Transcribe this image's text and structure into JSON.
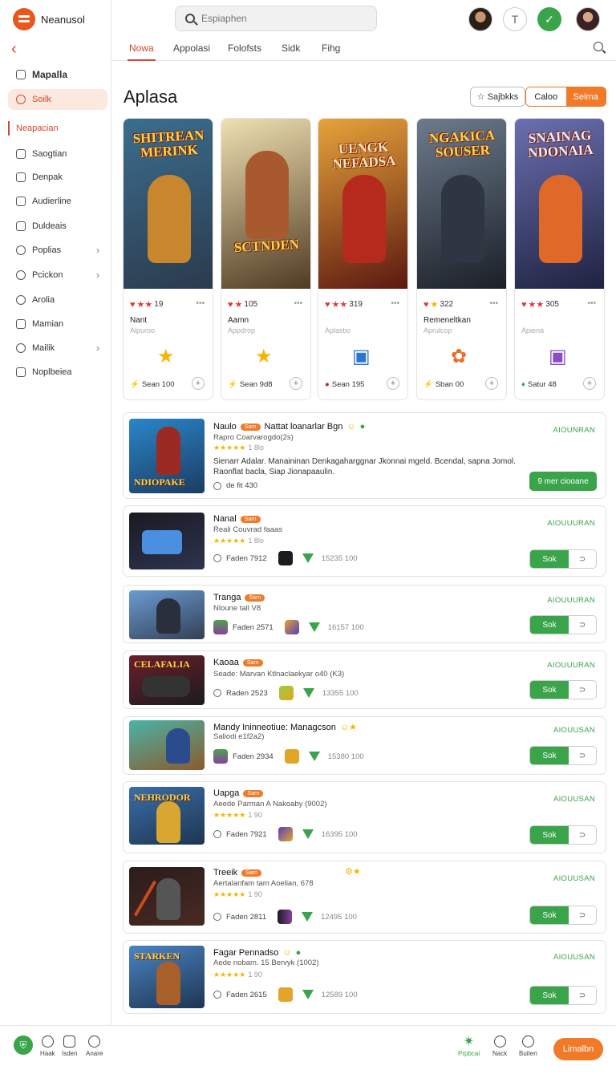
{
  "brand": {
    "name": "Neanusol"
  },
  "sidebar": {
    "items": [
      {
        "label": "Mapalla"
      },
      {
        "label": "Soilk"
      },
      {
        "label": "Neapacian"
      },
      {
        "label": "Saogtian"
      },
      {
        "label": "Denpak"
      },
      {
        "label": "Audierline"
      },
      {
        "label": "Duldeais"
      },
      {
        "label": "Poplias"
      },
      {
        "label": "Pcickon"
      },
      {
        "label": "Arolia"
      },
      {
        "label": "Mamian"
      },
      {
        "label": "Mailik"
      },
      {
        "label": "Noplbeiea"
      }
    ]
  },
  "search": {
    "placeholder": "Espiaphen"
  },
  "header": {
    "avatar_letter": "T"
  },
  "tabs": [
    {
      "label": "Nowa"
    },
    {
      "label": "Appolasi"
    },
    {
      "label": "Folofsts"
    },
    {
      "label": "Sidk"
    },
    {
      "label": "Fihg"
    }
  ],
  "page": {
    "title": "Aplasa",
    "btn_outline": "Sajbkks",
    "seg_left": "Caloo",
    "seg_right": "Seima"
  },
  "featured": [
    {
      "art_title": "SHITREAN MERINK",
      "rating": "19",
      "name": "Nant",
      "sub": "Alpuroo",
      "foot": "Sean 100",
      "colors": [
        "#3b6e8f",
        "#c8872c",
        "#2b3a4c"
      ]
    },
    {
      "art_title": "SCTNDEN",
      "rating": "105",
      "name": "Aamn",
      "sub": "Appdrop",
      "foot": "Sean 9d8",
      "colors": [
        "#efe0b2",
        "#a8592e",
        "#4f3a22"
      ]
    },
    {
      "art_title": "UENGK NEFADSA",
      "rating": "319",
      "name": "",
      "sub": "Aplastio",
      "foot": "Sean 195",
      "colors": [
        "#e7a33a",
        "#b62a1e",
        "#5b1810"
      ]
    },
    {
      "art_title": "NGAKICA SOUSER",
      "rating": "322",
      "name": "Remeneltkan",
      "sub": "Aprulcop",
      "foot": "Sban 00",
      "colors": [
        "#6c7b8c",
        "#2d3642",
        "#1b1f27"
      ]
    },
    {
      "art_title": "SNAINAG NDONAIA",
      "rating": "305",
      "name": "",
      "sub": "Apiena",
      "foot": "Satur 48",
      "colors": [
        "#6b6fb0",
        "#e0692a",
        "#1f2240"
      ]
    }
  ],
  "rows": [
    {
      "name": "Naulo",
      "tag": "Sarn",
      "name_extra": "Nattat loanarlar Bgn",
      "sub": "Rapro Coarvarogdo(2s)",
      "stars": "★★★★★",
      "stars_num": "1 8lo",
      "desc": "Sienarr Adalar. Manaininan Denkagaharggnar Jkonnai mgeld. Bcendal, sapna Jomol. Raonflat bacla, Siap Jionapaaulin.",
      "meta": "de fit 430",
      "status": "AIOUNRAN",
      "btn": "9 mer ciooane",
      "thumb_title": "NDIOPAKE",
      "colors": [
        "#2a86c9",
        "#9b2a22"
      ]
    },
    {
      "name": "Nanal",
      "tag": "Sarn",
      "sub": "Reali Couvrad faaas",
      "stars": "★★★★★",
      "stars_num": "1 8lo",
      "meta": "Faden 7912",
      "num": "15235 100",
      "status": "AIOUUURAN",
      "btn_g": "Sok",
      "btn_w": "⊃",
      "thumb_title": "",
      "colors": [
        "#1a1a22",
        "#4a8fe0"
      ]
    },
    {
      "name": "Tranga",
      "tag": "Sarn",
      "sub": "Nloune tall V8",
      "meta": "Faden 2571",
      "num": "16157 100",
      "status": "AIOUUURAN",
      "btn_g": "Sok",
      "btn_w": "⊃",
      "thumb_title": "",
      "colors": [
        "#6a9bd3",
        "#334055"
      ]
    },
    {
      "name": "Kaoaa",
      "tag": "Sarn",
      "sub": "Seade: Marvan Ktlnaclaekyar o40 (K3)",
      "meta": "Raden 2523",
      "num": "13355 100",
      "status": "AIOUUURAN",
      "btn_g": "Sok",
      "btn_w": "⊃",
      "thumb_title": "CELAFALIA",
      "colors": [
        "#6b1f2a",
        "#1b1b20"
      ]
    },
    {
      "name": "Mandy Ininneotiue: Managcson",
      "sub": "Saliodi e1f2a2)",
      "meta": "Faden 2934",
      "num": "15380 100",
      "status": "AIOUUSAN",
      "btn_g": "Sok",
      "btn_w": "⊃",
      "thumb_title": "",
      "colors": [
        "#49b3a8",
        "#8b5a2b"
      ]
    },
    {
      "name": "Uapga",
      "tag": "Sarn",
      "sub": "Aeede Parman A Nakoaby (9002)",
      "stars": "★★★★★",
      "stars_num": "1 90",
      "meta": "Faden 7921",
      "num": "16395 100",
      "status": "AIOUUSAN",
      "btn_g": "Sok",
      "btn_w": "⊃",
      "thumb_title": "NEHRODOR",
      "colors": [
        "#3a6ea8",
        "#d9a632"
      ]
    },
    {
      "name": "Treeik",
      "tag": "Sarn",
      "sub": "Aertalanfam tam Aoelian, 678",
      "stars": "★★★★★",
      "stars_num": "1 90",
      "meta": "Faden 2811",
      "num": "12495 100",
      "status": "AIOUUSAN",
      "btn_g": "Sok",
      "btn_w": "⊃",
      "thumb_title": "",
      "colors": [
        "#2a1c1c",
        "#c94a1e"
      ]
    },
    {
      "name": "Fagar Pennadso",
      "sub": "Aede nobam. 15 Bervyk (1002)",
      "stars": "★★★★★",
      "stars_num": "1 90",
      "meta": "Faden 2615",
      "num": "12589 100",
      "status": "AIOUUSAN",
      "btn_g": "Sok",
      "btn_w": "⊃",
      "thumb_title": "STARKEN",
      "colors": [
        "#4a84c2",
        "#a8602a"
      ]
    }
  ],
  "bottom": {
    "items": [
      {
        "label": "Haak"
      },
      {
        "label": "Isden"
      },
      {
        "label": "Anare"
      }
    ],
    "right_items": [
      {
        "label": "Prpbcai"
      },
      {
        "label": "Nack"
      },
      {
        "label": "Buiten"
      }
    ],
    "cta": "Limalbn"
  }
}
